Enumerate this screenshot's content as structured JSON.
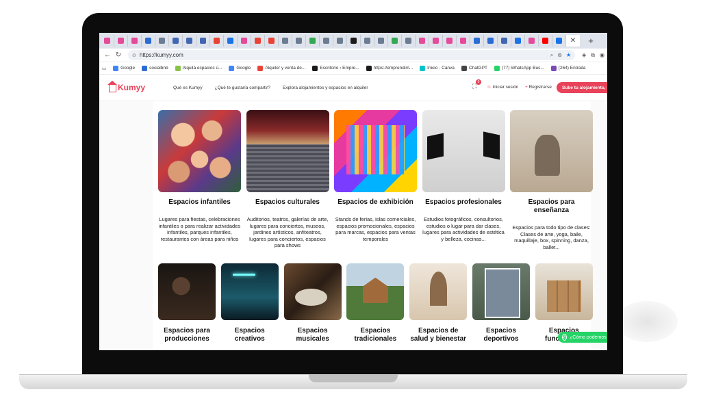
{
  "browser": {
    "tab_favicon_colors": [
      "#e64a9a",
      "#e64a9a",
      "#e64a9a",
      "#2b6cd4",
      "#6b7c93",
      "#4267b2",
      "#4267b2",
      "#4267b2",
      "#ea4335",
      "#1a73e8",
      "#e64a9a",
      "#ea4335",
      "#ea4335",
      "#6b7c93",
      "#6b7c93",
      "#34a853",
      "#6b7c93",
      "#6b7c93",
      "#1a1a1a",
      "#6b7c93",
      "#6b7c93",
      "#34a853",
      "#6b7c93",
      "#e64a9a",
      "#e64a9a",
      "#e64a9a",
      "#e64a9a",
      "#2b6cd4",
      "#2b6cd4",
      "#4267b2",
      "#1a73e8",
      "#e64a9a",
      "#ff0000",
      "#1a73e8"
    ],
    "close_glyph": "✕",
    "new_tab_glyph": "+",
    "url": "https://kumyy.com",
    "bookmarks": [
      {
        "label": "Google",
        "color": "#4285f4"
      },
      {
        "label": "socialbnb",
        "color": "#2b6cd4"
      },
      {
        "label": "Alquilá espacios ú...",
        "color": "#8bc34a"
      },
      {
        "label": "Google",
        "color": "#4285f4"
      },
      {
        "label": "Alquiler y venta de...",
        "color": "#ea4335"
      },
      {
        "label": "Escritorio ‹ Empre...",
        "color": "#1a1a1a"
      },
      {
        "label": "https://emprendim...",
        "color": "#1a1a1a"
      },
      {
        "label": "Inicio - Canva",
        "color": "#00c4cc"
      },
      {
        "label": "ChatGPT",
        "color": "#444444"
      },
      {
        "label": "(77) WhatsApp Bus...",
        "color": "#25d366"
      },
      {
        "label": "(264) Entrada",
        "color": "#7b4bb3"
      }
    ]
  },
  "site": {
    "brand": "Kumyy",
    "brand_color": "#e9425b",
    "nav": [
      "Qué es Kumyy",
      "¿Qué te gustaría compartir?",
      "Explora alojamientos y espacios en alquiler"
    ],
    "cart_count": "0",
    "login": "Iniciar sesión",
    "register": "Registrarse",
    "cta": "Sube tu alojamiento, esp"
  },
  "cards_row1": [
    {
      "title": "Espacios infantiles",
      "desc": "Lugares para fiestas, celebraciones infantiles o para realizar actividades infantiles, parques infantiles, restaurantes con áreas para niños"
    },
    {
      "title": "Espacios culturales",
      "desc": "Auditorios, teatros, galerías de arte, lugares para conciertos, museos, jardines artísticos, anfiteatros, lugares para conciertos, espacios para shows"
    },
    {
      "title": "Espacios de exhibición",
      "desc": "Stands de ferias, islas comerciales,  espacios promocionales, espacios para marcas, espacios para ventas temporales"
    },
    {
      "title": "Espacios profesionales",
      "desc": "Estudios fotográficos, consultorios, estudios o lugar para dar clases, lugares para actividades de estética y belleza, cocinas..."
    },
    {
      "title": "Espacios para enseñanza",
      "desc": "Espacios para todo tipo de clases: Clases de arte, yoga, baile, maquillaje, box, spinning, danza, ballet..."
    }
  ],
  "cards_row2": [
    {
      "line1": "Espacios para",
      "line2": "producciones"
    },
    {
      "line1": "Espacios",
      "line2": "creativos"
    },
    {
      "line1": "Espacios",
      "line2": "musicales"
    },
    {
      "line1": "Espacios",
      "line2": "tradicionales"
    },
    {
      "line1": "Espacios de",
      "line2": "salud y bienestar"
    },
    {
      "line1": "Espacios",
      "line2": "deportivos"
    },
    {
      "line1": "Espacios",
      "line2": "funcionales"
    }
  ],
  "whatsapp": {
    "label": "¿Cómo podemos",
    "color": "#25d366"
  }
}
